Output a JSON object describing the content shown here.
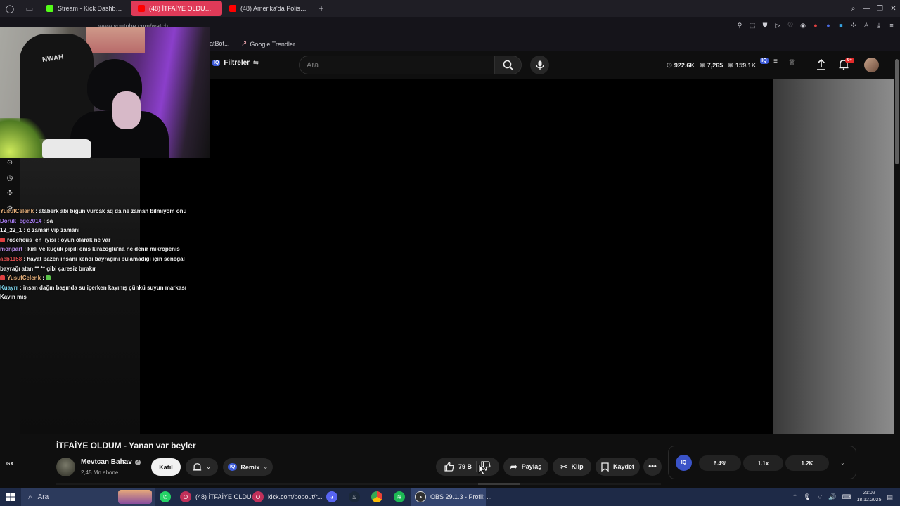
{
  "browser": {
    "tabs": [
      {
        "label": "Stream - Kick Dashboard",
        "favicon_color": "#53fc18"
      },
      {
        "label": "(48) İTFAİYE OLDUM - Ya",
        "favicon_color": "#ff0000"
      },
      {
        "label": "(48) Amerika'da Polisle G",
        "favicon_color": "#ff0000"
      }
    ],
    "url": "www.youtube.com/watch",
    "bookmarks": [
      "atBot...",
      "Google Trendler"
    ]
  },
  "youtube": {
    "filters_label": "Filtreler",
    "iq_badge": "IQ",
    "search_placeholder": "Ara",
    "stats": [
      "922.6K",
      "7,265",
      "159.1K"
    ],
    "notification_badge": "9+"
  },
  "webcam": {
    "chair_logo": "NWAH"
  },
  "chat": [
    {
      "user": "YusufCelenk",
      "user_color": "#e7b07a",
      "text": "ataberk abi bigün vurcak aq da ne zaman bilmiyom onu",
      "emote": false
    },
    {
      "user": "Doruk_ege2014",
      "user_color": "#a77cf0",
      "text": "sa",
      "emote": false
    },
    {
      "user": "12_22_1",
      "user_color": "#f0f0f0",
      "text": "o zaman vip zamanı",
      "emote": false
    },
    {
      "user": "roseheus_en_iyisi",
      "user_color": "#f0f0f0",
      "text": "oyun olarak ne var",
      "emote": true
    },
    {
      "user": "monpart",
      "user_color": "#b98ee8",
      "text": "kirli ve küçük pipili enis kirazoğlu'na ne denir mikropenis",
      "emote": false
    },
    {
      "user": "aeb1158",
      "user_color": "#e05050",
      "text": "hayat bazen insanı kendi bayrağını bulamadığı için senegal bayrağı atan ** ** gibi çaresiz bırakır",
      "emote": false
    },
    {
      "user": "YusufCelenk",
      "user_color": "#e7b07a",
      "text": "",
      "emote": true
    },
    {
      "user": "Kuayrr",
      "user_color": "#7ad0e6",
      "text": "insan dağın başında su içerken kayınış çünkü suyun markası Kayın mış",
      "emote": false
    }
  ],
  "left_nav": {
    "gx_label": "GX"
  },
  "video": {
    "title": "İTFAİYE OLDUM - Yanan var beyler",
    "channel_name": "Mevtcan Bahav",
    "subscribers": "2,45 Mn abone",
    "join_label": "Katıl",
    "remix_label": "Remix",
    "likes": "79 B",
    "share_label": "Paylaş",
    "clip_label": "Klip",
    "save_label": "Kaydet"
  },
  "iq_panel": {
    "logo": "IQ",
    "stats": [
      "6.4%",
      "1.1x",
      "1.2K"
    ]
  },
  "taskbar": {
    "search_label": "Ara",
    "apps": [
      {
        "label": "(48) İTFAİYE OLDU...",
        "color": "#c0305a"
      },
      {
        "label": "kick.com/popout/r...",
        "color": "#c0305a"
      },
      {
        "label": "OBS 29.1.3 - Profil: ...",
        "color": "#303030"
      }
    ],
    "time": "21:02",
    "date": "18.12.2025"
  }
}
